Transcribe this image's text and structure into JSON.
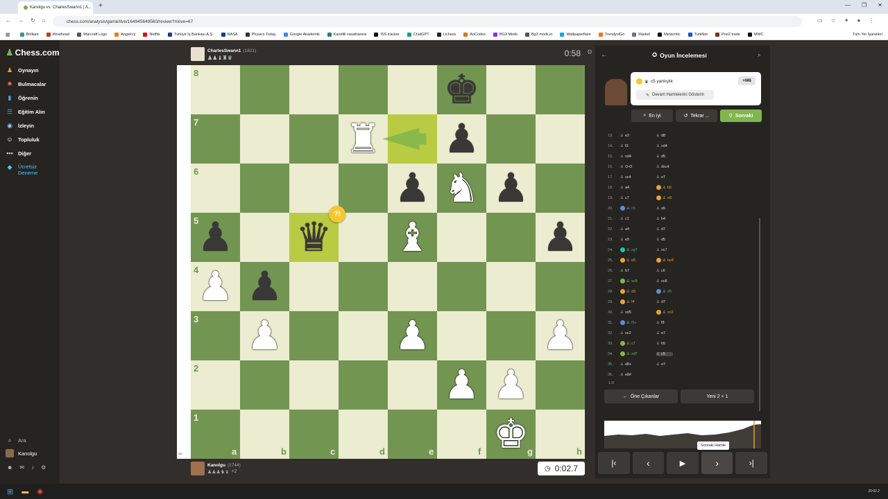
{
  "browser": {
    "tab_title": "Kanolgu vs. CharlesSwann1 | A...",
    "url": "chess.com/analysis/game/live/164945649560/review?move=67",
    "bookmarks": [
      {
        "label": "Brilliant",
        "color": "#2a9d8f"
      },
      {
        "label": "Wowhead",
        "color": "#c0392b"
      },
      {
        "label": "Warcraft Logs",
        "color": "#555555"
      },
      {
        "label": "Angelcry",
        "color": "#e67e22"
      },
      {
        "label": "Netflix",
        "color": "#e50914"
      },
      {
        "label": "Türkiye İş Bankası A.Ş.",
        "color": "#1e3a8a"
      },
      {
        "label": "NASA",
        "color": "#0b3d91"
      },
      {
        "label": "Physics Today",
        "color": "#333333"
      },
      {
        "label": "Google Akademik",
        "color": "#4285f4"
      },
      {
        "label": "Kandilli rasathanesi",
        "color": "#2c7a7b"
      },
      {
        "label": "ISS tracker",
        "color": "#111111"
      },
      {
        "label": "ChatGPT",
        "color": "#10a37f"
      },
      {
        "label": "Lichess",
        "color": "#222222"
      },
      {
        "label": "AoCodex",
        "color": "#d97706"
      },
      {
        "label": "BG3 Mods",
        "color": "#7c3aed"
      },
      {
        "label": "Bg3 mods.io",
        "color": "#555555"
      },
      {
        "label": "Wallpaperflare",
        "color": "#0ea5e9"
      },
      {
        "label": "TrendyolGo",
        "color": "#f97316"
      },
      {
        "label": "Market",
        "color": "#6b7280"
      },
      {
        "label": "Metacritic",
        "color": "#111111"
      },
      {
        "label": "TurkNet",
        "color": "#1d4ed8"
      },
      {
        "label": "Poe2 trade",
        "color": "#78350f"
      },
      {
        "label": "MWC",
        "color": "#111111"
      }
    ],
    "all_bookmarks": "Tüm Yer İşaretleri"
  },
  "nav": {
    "logo": "Chess.com",
    "items": [
      {
        "label": "Oynayın",
        "icon": "♟",
        "color": "#f0a030"
      },
      {
        "label": "Bulmacalar",
        "icon": "✸",
        "color": "#e8703a"
      },
      {
        "label": "Öğrenin",
        "icon": "▮",
        "color": "#4aa3df"
      },
      {
        "label": "Eğitim Alın",
        "icon": "☰",
        "color": "#4aa3df"
      },
      {
        "label": "İzleyin",
        "icon": "◉",
        "color": "#a0c4ff"
      },
      {
        "label": "Topluluk",
        "icon": "☺",
        "color": "#ffffff"
      },
      {
        "label": "Diğer",
        "icon": "•••",
        "color": "#cccccc"
      }
    ],
    "trial": "Ücretsiz Deneme",
    "search": "Ara",
    "username": "Kanolgu"
  },
  "top_player": {
    "name": "CharlesSwann1",
    "rating": "(1821)",
    "clock": "0:58"
  },
  "bottom_player": {
    "name": "Kanolgu",
    "rating": "(1744)",
    "extra": "+2",
    "clock": "0:02.7"
  },
  "board": {
    "files": [
      "a",
      "b",
      "c",
      "d",
      "e",
      "f",
      "g",
      "h"
    ],
    "ranks": [
      "8",
      "7",
      "6",
      "5",
      "4",
      "3",
      "2",
      "1"
    ],
    "pieces": [
      {
        "sq": "f8",
        "p": "♚",
        "c": "b"
      },
      {
        "sq": "d7",
        "p": "♜",
        "c": "w"
      },
      {
        "sq": "f7",
        "p": "♟",
        "c": "b"
      },
      {
        "sq": "e6",
        "p": "♟",
        "c": "b"
      },
      {
        "sq": "f6",
        "p": "♞",
        "c": "w"
      },
      {
        "sq": "g6",
        "p": "♟",
        "c": "b"
      },
      {
        "sq": "a5",
        "p": "♟",
        "c": "b"
      },
      {
        "sq": "c5",
        "p": "♛",
        "c": "b"
      },
      {
        "sq": "e5",
        "p": "♝",
        "c": "w"
      },
      {
        "sq": "h5",
        "p": "♟",
        "c": "b"
      },
      {
        "sq": "a4",
        "p": "♟",
        "c": "w"
      },
      {
        "sq": "b4",
        "p": "♟",
        "c": "b"
      },
      {
        "sq": "b3",
        "p": "♟",
        "c": "w"
      },
      {
        "sq": "e3",
        "p": "♟",
        "c": "w"
      },
      {
        "sq": "h3",
        "p": "♟",
        "c": "w"
      },
      {
        "sq": "f2",
        "p": "♟",
        "c": "w"
      },
      {
        "sq": "g2",
        "p": "♟",
        "c": "w"
      },
      {
        "sq": "g1",
        "p": "♚",
        "c": "w"
      }
    ],
    "highlights": [
      "c5",
      "e7"
    ],
    "annotation_badge": "?!"
  },
  "review": {
    "title": "Oyun İncelemesi",
    "coach_text": "c5 yanlışlık",
    "eval": "+M6",
    "show_moves": "Devam Hamlelerini Gösterin",
    "best": "En iyi",
    "retry": "Tekrar ...",
    "next": "Sonraki",
    "moves": [
      {
        "n": "13.",
        "w": "e2",
        "wb": "",
        "b": "d8",
        "bb": ""
      },
      {
        "n": "14.",
        "w": "f3",
        "wb": "",
        "b": "xd4",
        "bb": ""
      },
      {
        "n": "15.",
        "w": "xd4",
        "wb": "",
        "b": "d5",
        "bb": ""
      },
      {
        "n": "16.",
        "w": "O-O",
        "wb": "",
        "b": "dxc4",
        "bb": ""
      },
      {
        "n": "17.",
        "w": "xc4",
        "wb": "",
        "b": "e7",
        "bb": ""
      },
      {
        "n": "18.",
        "w": "a4",
        "wb": "",
        "b": "b5",
        "bb": "#f0a030"
      },
      {
        "n": "19.",
        "w": "c7",
        "wb": "",
        "b": "e8",
        "bb": "#f0a030"
      },
      {
        "n": "20.",
        "w": "c5",
        "wb": "#5b8fd6",
        "b": "a5",
        "bb": ""
      },
      {
        "n": "21.",
        "w": "c1",
        "wb": "",
        "b": "b4",
        "bb": ""
      },
      {
        "n": "22.",
        "w": "a4",
        "wb": "",
        "b": "d7",
        "bb": ""
      },
      {
        "n": "23.",
        "w": "e5",
        "wb": "",
        "b": "d5",
        "bb": ""
      },
      {
        "n": "24.",
        "w": "xg7",
        "wb": "#26c2a3",
        "b": "xc7",
        "bb": ""
      },
      {
        "n": "25.",
        "w": "e5",
        "wb": "#f0a030",
        "b": "bc8",
        "bb": "#f0a030"
      },
      {
        "n": "26.",
        "w": "b7",
        "wb": "",
        "b": "c6",
        "bb": ""
      },
      {
        "n": "27.",
        "w": "xc8",
        "wb": "#81b64c",
        "b": "xc8",
        "bb": ""
      },
      {
        "n": "28.",
        "w": "d3",
        "wb": "#f0a030",
        "b": "d5",
        "bb": "#5b8fd6"
      },
      {
        "n": "29.",
        "w": "f4",
        "wb": "#f0a030",
        "b": "d7",
        "bb": ""
      },
      {
        "n": "30.",
        "w": "xd5",
        "wb": "",
        "b": "xc2",
        "bb": "#f0a030"
      },
      {
        "n": "31.",
        "w": "f6+",
        "wb": "#5b8fd6",
        "b": "f8",
        "bb": ""
      },
      {
        "n": "32.",
        "w": "xc2",
        "wb": "",
        "b": "e7",
        "bb": ""
      },
      {
        "n": "33.",
        "w": "c7",
        "wb": "#81b64c",
        "b": "h5",
        "bb": ""
      },
      {
        "n": "34.",
        "w": "xd7",
        "wb": "#81b64c",
        "b": "c5",
        "bb": ""
      },
      {
        "n": "35.",
        "w": "d8+",
        "wb": "",
        "b": "e7",
        "bb": ""
      },
      {
        "n": "36.",
        "w": "e8#",
        "wb": "",
        "b": "",
        "bb": ""
      }
    ],
    "result": "1-0",
    "highlights_btn": "Öne Çıkanlar",
    "new_game_btn": "Yeni 2 + 1",
    "tooltip": "Sonraki Hamle"
  },
  "taskbar": {
    "time": "20:02.2"
  }
}
